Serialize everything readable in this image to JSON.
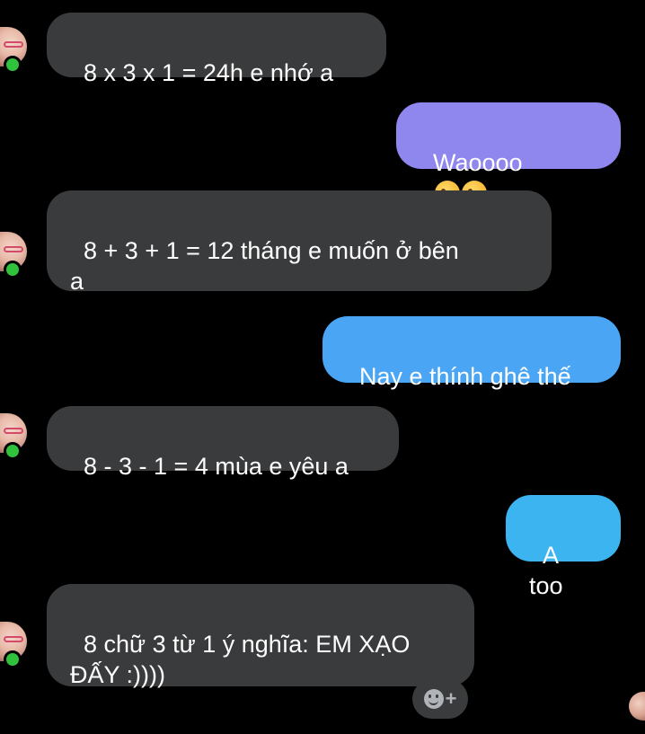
{
  "messages": [
    {
      "direction": "in",
      "text": "8 x 3 x 1 = 24h e nhớ a"
    },
    {
      "direction": "out",
      "text": "Waoooo",
      "emoji": "kissing-heart-emoji",
      "color": "#8f86ee"
    },
    {
      "direction": "in",
      "text": "8 + 3 + 1 = 12 tháng e muốn ở bên\na"
    },
    {
      "direction": "out",
      "text": "Nay e thính ghê thế",
      "color": "#4aa6f5"
    },
    {
      "direction": "in",
      "text": "8 - 3 - 1 = 4 mùa e yêu a"
    },
    {
      "direction": "out",
      "text": "A too",
      "color": "#3bb4f0"
    },
    {
      "direction": "in",
      "text": "8 chữ 3 từ 1 ý nghĩa: EM XẠO\nĐẤY :))))"
    }
  ],
  "reaction_button": {
    "icon": "add-reaction-icon",
    "plus": "+"
  },
  "colors": {
    "background": "#000000",
    "incoming_bubble": "#3a3b3c",
    "online_dot": "#31c23d"
  }
}
